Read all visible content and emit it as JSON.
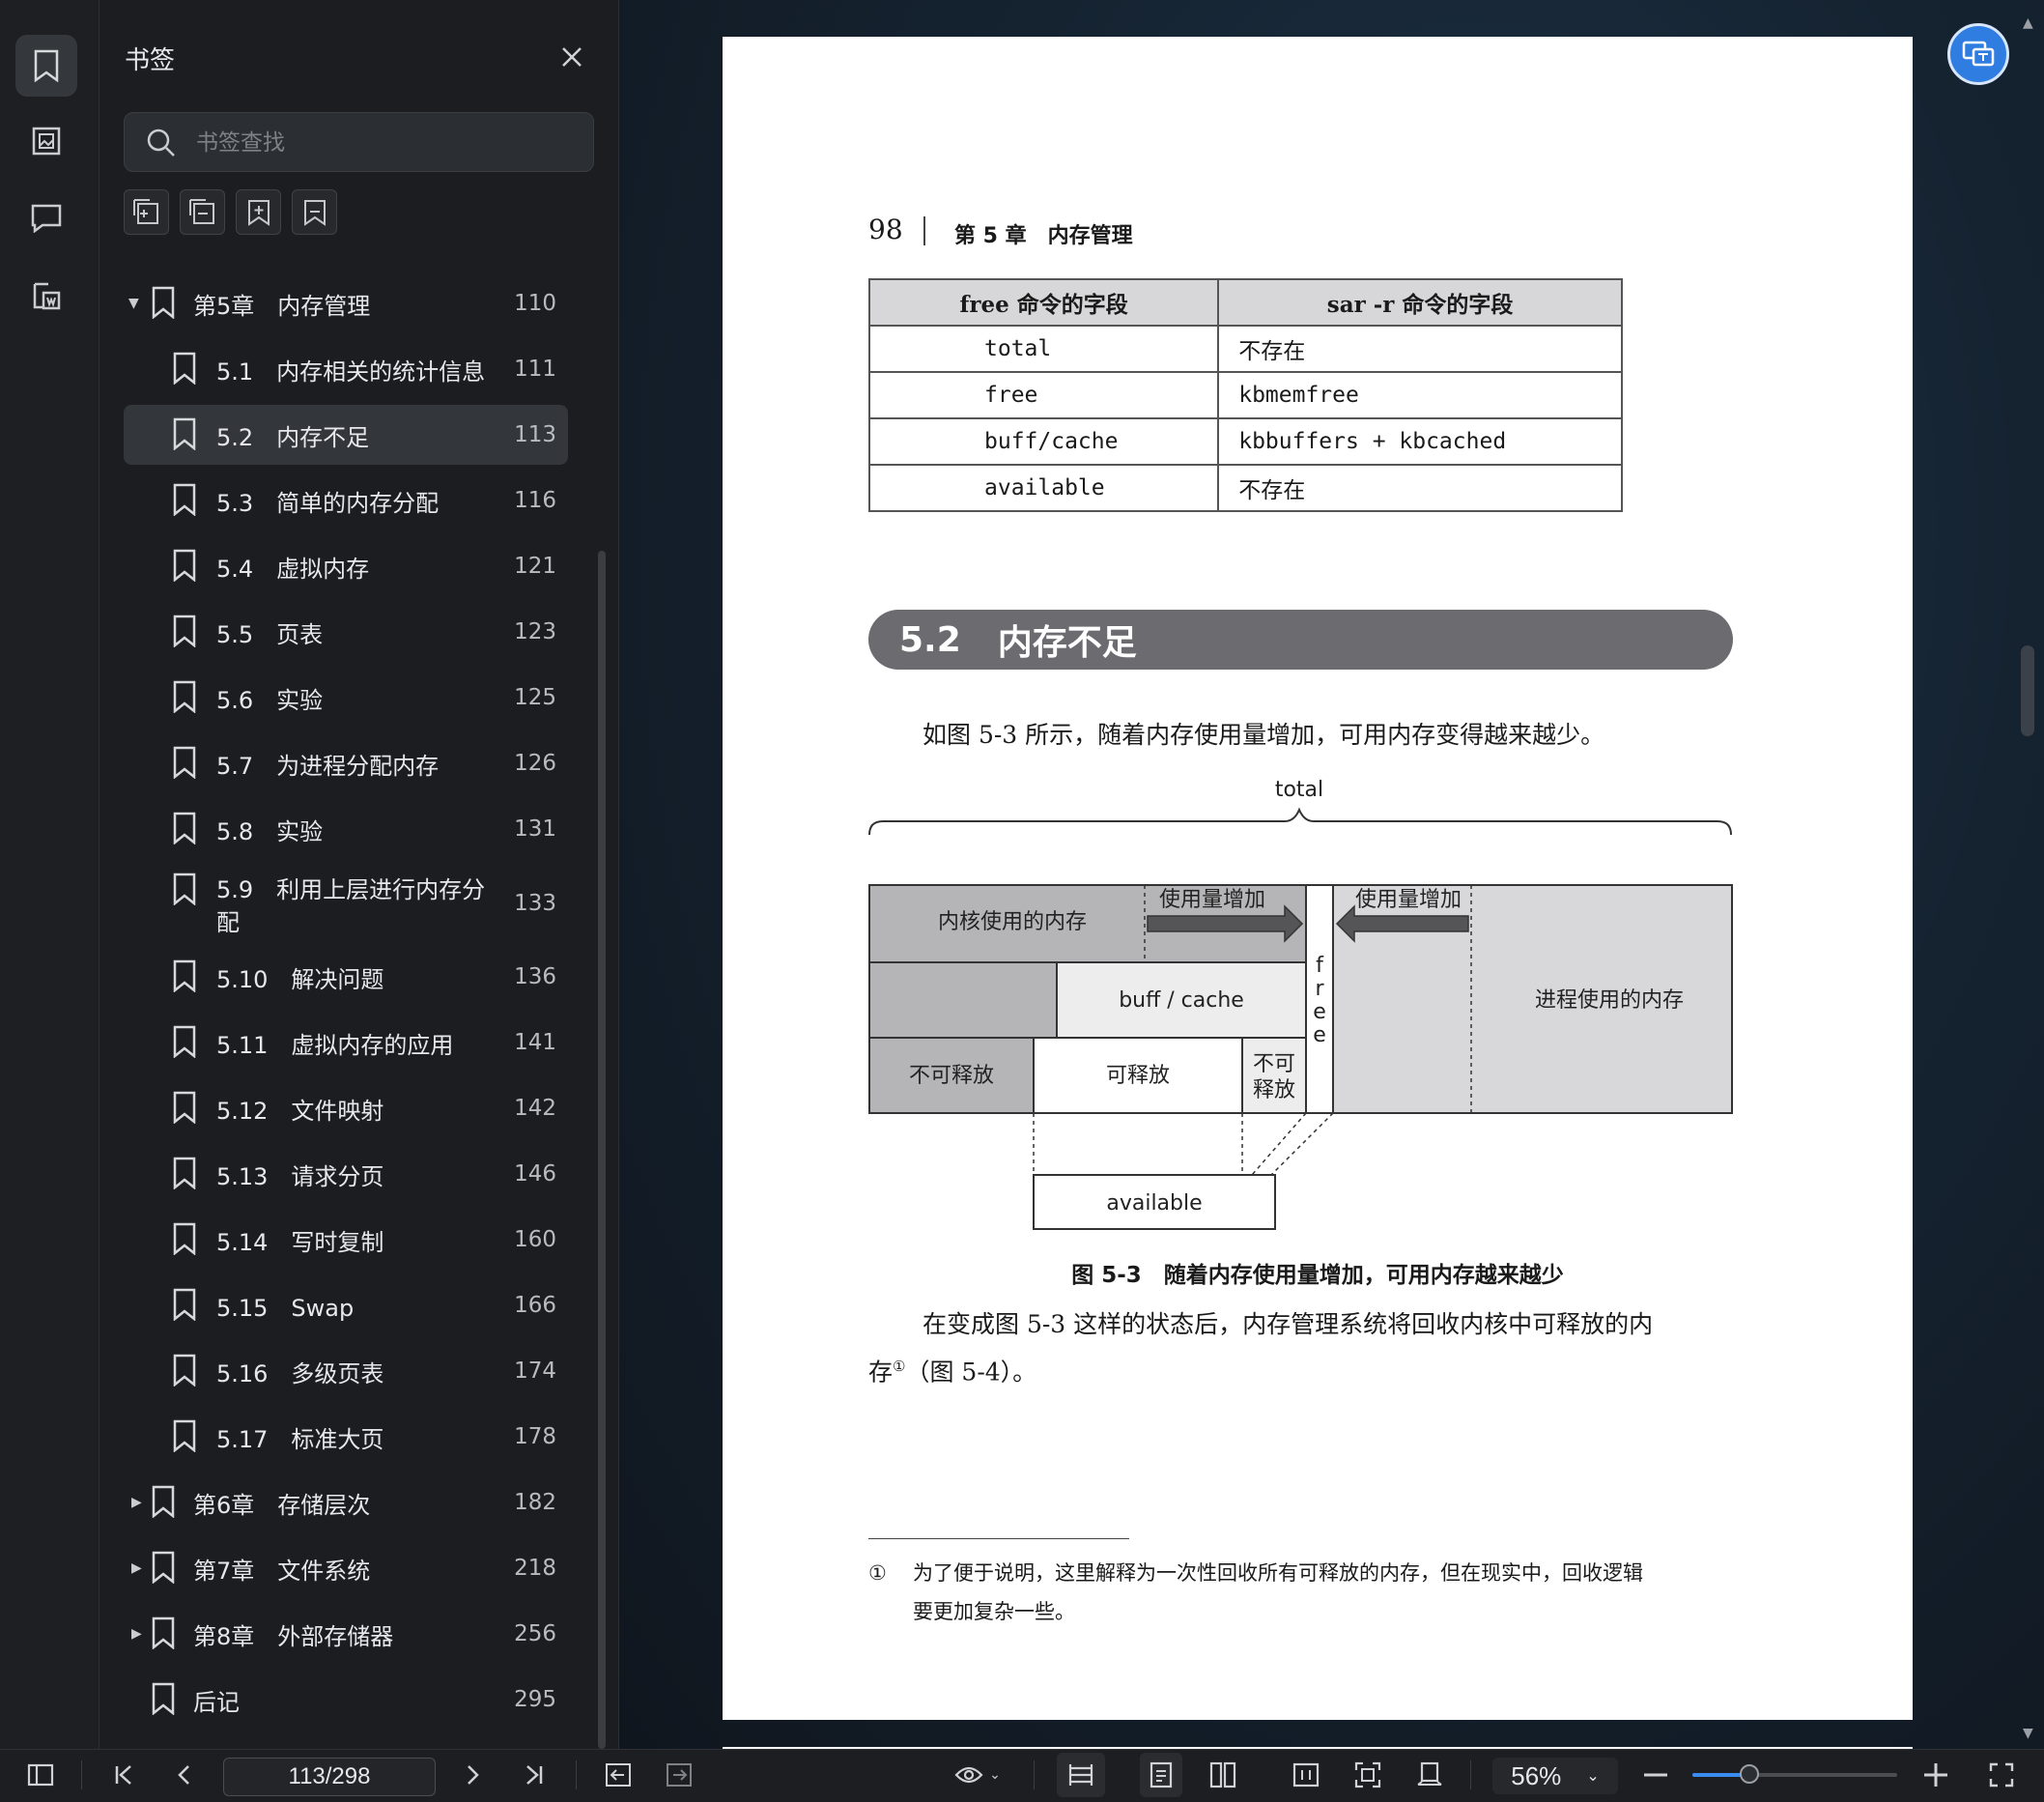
{
  "sidebar_rail": {
    "icons": [
      "bookmark-icon",
      "image-icon",
      "comment-icon",
      "export-icon"
    ]
  },
  "bookmarks_panel": {
    "title": "书签",
    "search_placeholder": "书签查找",
    "tools": [
      "expand-all-icon",
      "collapse-all-icon",
      "add-bookmark-icon",
      "bookmark-icon"
    ],
    "items": [
      {
        "label": "第5章　内存管理",
        "page": "110",
        "level": 0,
        "expanded": true
      },
      {
        "label": "5.1　内存相关的统计信息",
        "page": "111",
        "level": 1
      },
      {
        "label": "5.2　内存不足",
        "page": "113",
        "level": 1,
        "selected": true
      },
      {
        "label": "5.3　简单的内存分配",
        "page": "116",
        "level": 1
      },
      {
        "label": "5.4　虚拟内存",
        "page": "121",
        "level": 1
      },
      {
        "label": "5.5　页表",
        "page": "123",
        "level": 1
      },
      {
        "label": "5.6　实验",
        "page": "125",
        "level": 1
      },
      {
        "label": "5.7　为进程分配内存",
        "page": "126",
        "level": 1
      },
      {
        "label": "5.8　实验",
        "page": "131",
        "level": 1
      },
      {
        "label": "5.9　利用上层进行内存分",
        "label2": "配",
        "page": "133",
        "level": 1
      },
      {
        "label": "5.10　解决问题",
        "page": "136",
        "level": 1
      },
      {
        "label": "5.11　虚拟内存的应用",
        "page": "141",
        "level": 1
      },
      {
        "label": "5.12　文件映射",
        "page": "142",
        "level": 1
      },
      {
        "label": "5.13　请求分页",
        "page": "146",
        "level": 1
      },
      {
        "label": "5.14　写时复制",
        "page": "160",
        "level": 1
      },
      {
        "label": "5.15　Swap",
        "page": "166",
        "level": 1
      },
      {
        "label": "5.16　多级页表",
        "page": "174",
        "level": 1
      },
      {
        "label": "5.17　标准大页",
        "page": "178",
        "level": 1
      },
      {
        "label": "第6章　存储层次",
        "page": "182",
        "level": 0,
        "expanded": false
      },
      {
        "label": "第7章　文件系统",
        "page": "218",
        "level": 0,
        "expanded": false
      },
      {
        "label": "第8章　外部存储器",
        "page": "256",
        "level": 0,
        "expanded": false
      },
      {
        "label": "后记",
        "page": "295",
        "level": 0
      }
    ]
  },
  "page": {
    "page_number": "98",
    "chapter_header": "第 5 章　内存管理",
    "table": {
      "headers": [
        "free 命令的字段",
        "sar -r 命令的字段"
      ],
      "rows": [
        [
          "total",
          "不存在"
        ],
        [
          "free",
          "kbmemfree"
        ],
        [
          "buff/cache",
          "kbbuffers + kbcached"
        ],
        [
          "available",
          "不存在"
        ]
      ]
    },
    "section_number": "5.2",
    "section_title": "内存不足",
    "intro": "如图 5-3 所示，随着内存使用量增加，可用内存变得越来越少。",
    "diagram": {
      "total": "total",
      "kernel_mem": "内核使用的内存",
      "usage_increase_left": "使用量增加",
      "usage_increase_right": "使用量增加",
      "buff_cache": "buff / cache",
      "free": "free",
      "process_mem": "进程使用的内存",
      "non_releasable_left": "不可释放",
      "releasable": "可释放",
      "non_releasable_small_1": "不可",
      "non_releasable_small_2": "释放",
      "available": "available"
    },
    "figure_caption": "图 5-3　随着内存使用量增加，可用内存越来越少",
    "body_line1": "在变成图 5-3 这样的状态后，内存管理系统将回收内核中可释放的内",
    "body_line2_a": "存",
    "body_footnote_mark": "①",
    "body_line2_b": "（图 5-4）。",
    "footnote_mark": "①",
    "footnote_line1": "为了便于说明，这里解释为一次性回收所有可释放的内存，但在现实中，回收逻辑",
    "footnote_line2": "要更加复杂一些。"
  },
  "bottom_toolbar": {
    "page_indicator": "113/298",
    "zoom_level": "56%",
    "zoom_fraction": 0.28
  },
  "colors": {
    "accent": "#2f7de1",
    "section_banner": "#6b6b70"
  }
}
